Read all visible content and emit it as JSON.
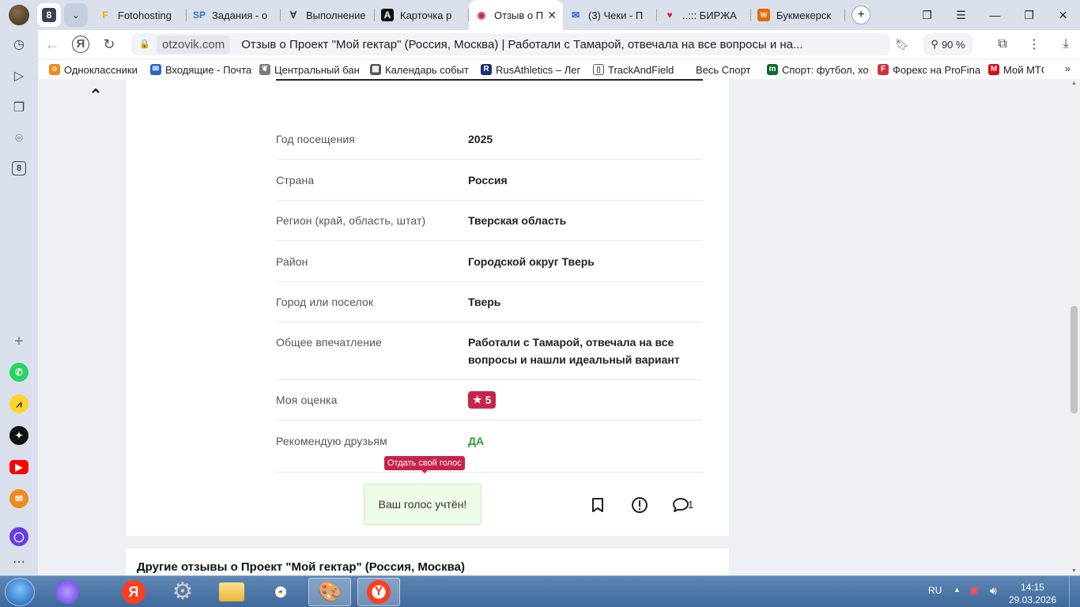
{
  "browser": {
    "tab_count": "8",
    "tabs": [
      {
        "title": "Fotohosting",
        "icon_color": "#f5a800",
        "icon_glyph": "F"
      },
      {
        "title": "Задания - о",
        "icon_color": "#3c74c8",
        "icon_glyph": "SP"
      },
      {
        "title": "Выполнение",
        "icon_color": "#333333",
        "icon_glyph": "∀"
      },
      {
        "title": "Карточка р",
        "icon_color": "#111111",
        "icon_glyph": "A"
      },
      {
        "title": "Отзыв о П",
        "icon_color": "#c8244b",
        "icon_glyph": "◉"
      },
      {
        "title": "(3) Чеки - П",
        "icon_color": "#2a62d6",
        "icon_glyph": "✉"
      },
      {
        "title": "..::: БИРЖА",
        "icon_color": "#e0203a",
        "icon_glyph": "♥"
      },
      {
        "title": "Букмекерск",
        "icon_color": "#e46a00",
        "icon_glyph": "W"
      }
    ],
    "url_domain": "otzovik.com",
    "url_title": "Отзыв о Проект \"Мой гектар\" (Россия, Москва) | Работали с Тамарой, отвечала на все вопросы и на...",
    "zoom": "90 %",
    "bookmarks": [
      {
        "label": "Одноклассники",
        "color": "#f08a1c"
      },
      {
        "label": "Входящие - Почта",
        "color": "#2a62d6"
      },
      {
        "label": "Центральный бан",
        "color": "#7a7a7a"
      },
      {
        "label": "Календарь событ",
        "color": "#555555"
      },
      {
        "label": "RusAthletics – Лег",
        "color": "#1b2e74"
      },
      {
        "label": "TrackAndField",
        "color": "#ffffff"
      },
      {
        "label": "Весь Спорт",
        "color": "#ffffff"
      },
      {
        "label": "Спорт: футбол, хо",
        "color": "#0d6b2d"
      },
      {
        "label": "Форекс на ProFina",
        "color": "#d2303a"
      },
      {
        "label": "Мой МТС",
        "color": "#e30611"
      }
    ]
  },
  "review": {
    "rows": [
      {
        "label": "Год посещения",
        "value": "2025"
      },
      {
        "label": "Страна",
        "value": "Россия"
      },
      {
        "label": "Регион (край, область, штат)",
        "value": "Тверская область"
      },
      {
        "label": "Район",
        "value": "Городской округ Тверь"
      },
      {
        "label": "Город или поселок",
        "value": "Тверь"
      },
      {
        "label": "Общее впечатление",
        "value": "Работали с Тамарой, отвечала на все вопросы и нашли идеальный вариант"
      },
      {
        "label": "Моя оценка",
        "value": "5"
      },
      {
        "label": "Рекомендую друзьям",
        "value": "ДА"
      }
    ],
    "tooltip": "Отдать свой голос",
    "vote_status": "Ваш голос учтён!",
    "comment_count": "1",
    "accent_color": "#c8244b",
    "yes_color": "#2e9b3a"
  },
  "other_reviews": {
    "heading": "Другие отзывы о Проект \"Мой гектар\" (Россия, Москва)"
  },
  "taskbar": {
    "lang": "RU",
    "time": "14:15",
    "date": "29.03.2026"
  }
}
